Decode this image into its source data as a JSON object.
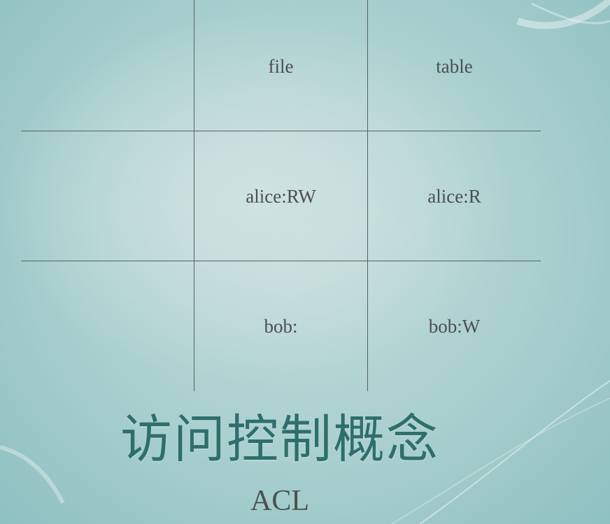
{
  "table": {
    "header": [
      "",
      "file",
      "table"
    ],
    "rows": [
      [
        "",
        "alice:RW",
        "alice:R"
      ],
      [
        "",
        "bob:",
        "bob:W"
      ]
    ]
  },
  "title": "访问控制概念",
  "subtitle": "ACL"
}
